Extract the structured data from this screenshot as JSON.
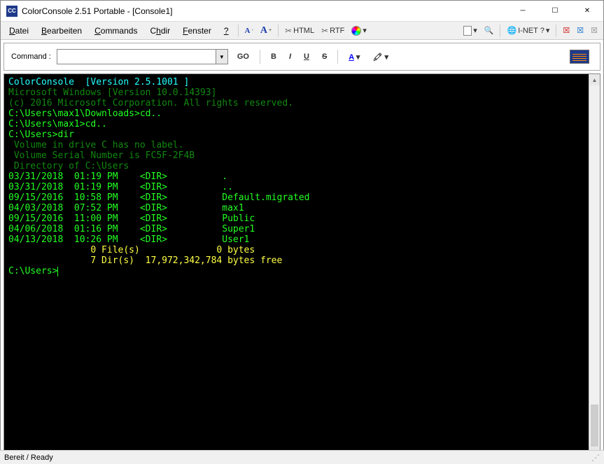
{
  "title": "ColorConsole 2.51 Portable - [Console1]",
  "menu": {
    "items": [
      {
        "label": "Datei",
        "u": 0
      },
      {
        "label": "Bearbeiten",
        "u": 0
      },
      {
        "label": "Commands",
        "u": 0
      },
      {
        "label": "Chdir",
        "u": 0
      },
      {
        "label": "Fenster",
        "u": 0
      },
      {
        "label": "?",
        "u": 0
      }
    ],
    "html_btn": "HTML",
    "rtf_btn": "RTF",
    "inet_btn": "I-NET ?"
  },
  "cmdbar": {
    "label": "Command :",
    "value": "",
    "go": "GO",
    "bold": "B",
    "italic": "I",
    "underline": "U",
    "strike": "S",
    "fontA": "A"
  },
  "console": {
    "lines": [
      {
        "cls": "c",
        "t": "ColorConsole  [Version 2.5.1001 ]"
      },
      {
        "cls": "dg",
        "t": "Microsoft Windows [Version 10.0.14393]"
      },
      {
        "cls": "dg",
        "t": "(c) 2016 Microsoft Corporation. All rights reserved."
      },
      {
        "cls": "g",
        "t": ""
      },
      {
        "cls": "g",
        "t": "C:\\Users\\max1\\Downloads>cd.."
      },
      {
        "cls": "g",
        "t": ""
      },
      {
        "cls": "g",
        "t": "C:\\Users\\max1>cd.."
      },
      {
        "cls": "g",
        "t": ""
      },
      {
        "cls": "g",
        "t": "C:\\Users>dir"
      },
      {
        "cls": "dg",
        "t": " Volume in drive C has no label."
      },
      {
        "cls": "dg",
        "t": " Volume Serial Number is FC5F-2F4B"
      },
      {
        "cls": "g",
        "t": ""
      },
      {
        "cls": "dg",
        "t": " Directory of C:\\Users"
      },
      {
        "cls": "g",
        "t": ""
      },
      {
        "cls": "g",
        "t": "03/31/2018  01:19 PM    <DIR>          ."
      },
      {
        "cls": "g",
        "t": "03/31/2018  01:19 PM    <DIR>          .."
      },
      {
        "cls": "g",
        "t": "09/15/2016  10:58 PM    <DIR>          Default.migrated"
      },
      {
        "cls": "g",
        "t": "04/03/2018  07:52 PM    <DIR>          max1"
      },
      {
        "cls": "g",
        "t": "09/15/2016  11:00 PM    <DIR>          Public"
      },
      {
        "cls": "g",
        "t": "04/06/2018  01:16 PM    <DIR>          Super1"
      },
      {
        "cls": "g",
        "t": "04/13/2018  10:26 PM    <DIR>          User1"
      },
      {
        "cls": "y",
        "t": "               0 File(s)              0 bytes"
      },
      {
        "cls": "y",
        "t": "               7 Dir(s)  17,972,342,784 bytes free"
      },
      {
        "cls": "g",
        "t": ""
      },
      {
        "cls": "g",
        "t": "C:\\Users>",
        "cursor": true
      }
    ]
  },
  "status": "Bereit / Ready"
}
